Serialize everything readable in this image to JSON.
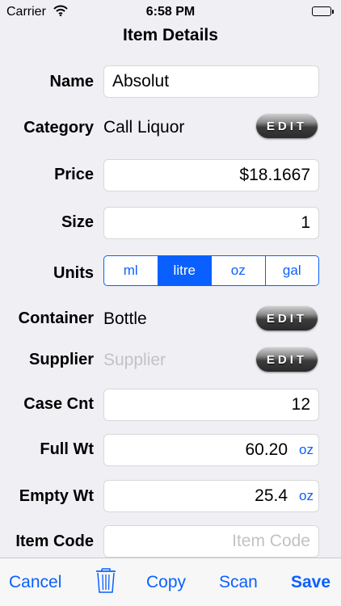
{
  "status_bar": {
    "carrier": "Carrier",
    "time": "6:58 PM",
    "battery_level": 1.0
  },
  "nav": {
    "title": "Item Details"
  },
  "form": {
    "name": {
      "label": "Name",
      "value": "Absolut"
    },
    "category": {
      "label": "Category",
      "value": "Call Liquor",
      "edit_label": "EDIT"
    },
    "price": {
      "label": "Price",
      "value": "$18.1667"
    },
    "size": {
      "label": "Size",
      "value": "1"
    },
    "units": {
      "label": "Units",
      "options": [
        "ml",
        "litre",
        "oz",
        "gal"
      ],
      "selected": "litre"
    },
    "container": {
      "label": "Container",
      "value": "Bottle",
      "edit_label": "EDIT"
    },
    "supplier": {
      "label": "Supplier",
      "placeholder": "Supplier",
      "edit_label": "EDIT"
    },
    "case_cnt": {
      "label": "Case Cnt",
      "value": "12"
    },
    "full_wt": {
      "label": "Full Wt",
      "value": "60.20",
      "unit": "oz"
    },
    "empty_wt": {
      "label": "Empty Wt",
      "value": "25.4",
      "unit": "oz"
    },
    "item_code": {
      "label": "Item Code",
      "placeholder": "Item Code"
    }
  },
  "toolbar": {
    "cancel": "Cancel",
    "trash_icon": "trash-icon",
    "copy": "Copy",
    "scan": "Scan",
    "save": "Save"
  },
  "colors": {
    "accent": "#0a60ff",
    "background": "#efeff4",
    "placeholder": "#c2c2c7"
  }
}
